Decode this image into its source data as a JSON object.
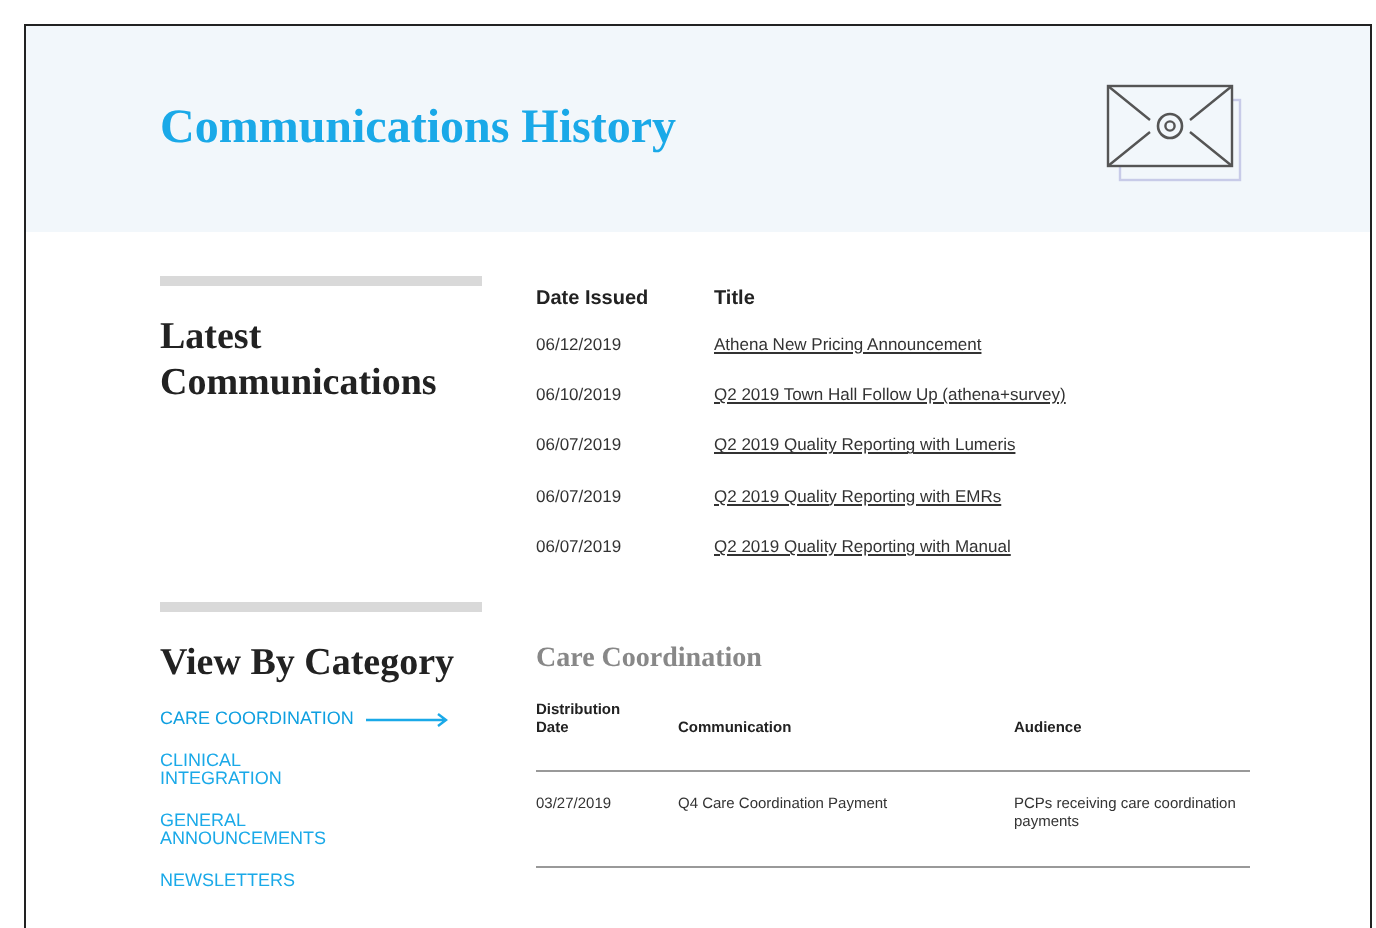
{
  "header": {
    "title": "Communications History"
  },
  "latest": {
    "heading": "Latest Communications",
    "columns": [
      "Date Issued",
      "Title"
    ],
    "rows": [
      {
        "date": "06/12/2019",
        "title": "Athena New Pricing Announcement"
      },
      {
        "date": "06/10/2019",
        "title": "Q2 2019 Town Hall Follow Up (athena+survey)"
      },
      {
        "date": "06/07/2019",
        "title": "Q2 2019 Quality Reporting with Lumeris"
      },
      {
        "date": "06/07/2019",
        "title": "Q2 2019 Quality Reporting with EMRs"
      },
      {
        "date": "06/07/2019",
        "title": "Q2 2019 Quality Reporting with Manual"
      }
    ]
  },
  "category": {
    "heading": "View By Category",
    "items": [
      {
        "label": "CARE COORDINATION",
        "selected": true
      },
      {
        "label": "CLINICAL INTEGRATION",
        "selected": false
      },
      {
        "label": "GENERAL ANNOUNCEMENTS",
        "selected": false
      },
      {
        "label": "NEWSLETTERS",
        "selected": false
      }
    ],
    "section_title": "Care Coordination",
    "columns": [
      "Distribution Date",
      "Communication",
      "Audience"
    ],
    "rows": [
      {
        "date": "03/27/2019",
        "communication": "Q4 Care Coordination Payment",
        "audience": "PCPs receiving care coordination payments"
      }
    ]
  }
}
